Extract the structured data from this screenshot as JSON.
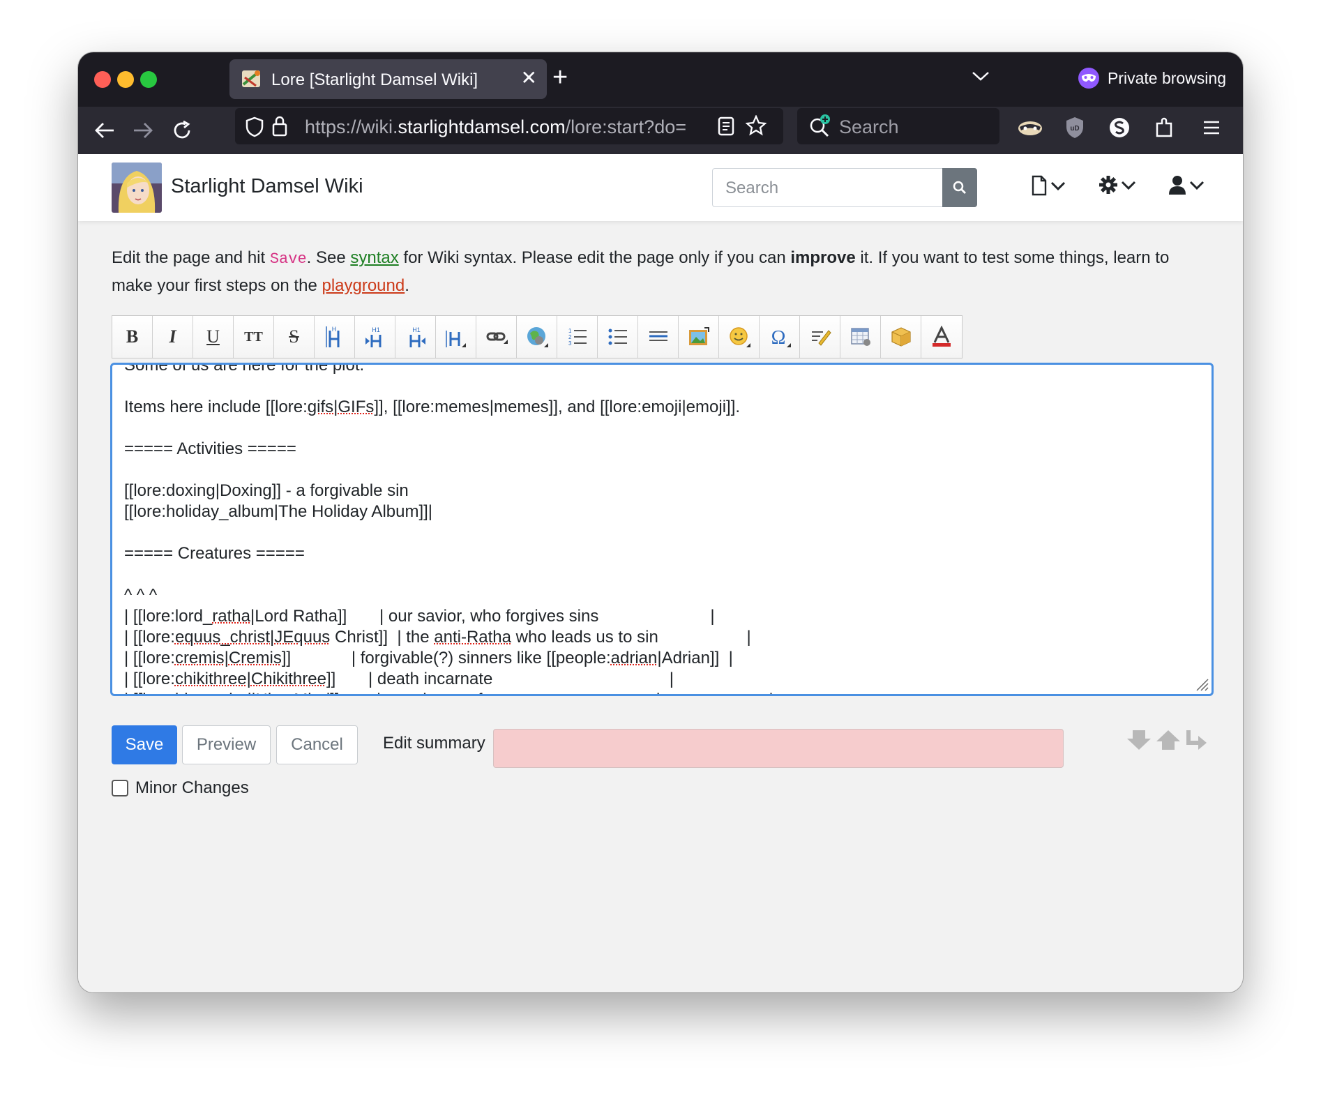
{
  "browser": {
    "tab_title": "Lore [Starlight Damsel Wiki]",
    "private_label": "Private browsing",
    "url_prefix": "https://wiki.",
    "url_domain": "starlightdamsel.com",
    "url_path": "/lore:start?do=",
    "search_placeholder": "Search"
  },
  "wiki": {
    "site_title": "Starlight Damsel Wiki",
    "search_placeholder": "Search"
  },
  "intro": {
    "t1": "Edit the page and hit ",
    "save": "Save",
    "t2": ". See ",
    "syntax": "syntax",
    "t3": " for Wiki syntax. Please edit the page only if you can ",
    "improve": "improve",
    "t4": " it. If you want to test some things, learn to make your first steps on the ",
    "playground": "playground",
    "t5": "."
  },
  "toolbar": {
    "buttons": [
      "bold",
      "italic",
      "underline",
      "monospace",
      "strikethrough",
      "heading-same",
      "heading-lower",
      "heading-higher",
      "heading-select",
      "link",
      "external-link",
      "ordered-list",
      "unordered-list",
      "horizontal-rule",
      "media",
      "smileys",
      "special-chars",
      "signature",
      "table",
      "plugin",
      "color"
    ]
  },
  "editor": {
    "l0": "Some of us are here for the plot.",
    "l1a": "Items here include [[lore:",
    "l1b": "gifs",
    "l1c": "|",
    "l1d": "GIFs",
    "l1e": "]], [[lore:memes|memes]], and [[lore:emoji|emoji]].",
    "l2": "===== Activities =====",
    "l3": "[[lore:doxing|Doxing]] - a forgivable sin",
    "l4": "[[lore:holiday_album|The Holiday Album]]|",
    "l5": "===== Creatures =====",
    "l6": "^ ^ ^",
    "r1a": "| [[lore:lord_",
    "r1b": "ratha",
    "r1c": "|Lord Ratha]]       | our savior, who forgives sins                        |",
    "r2a": "| [[lore:",
    "r2b": "equus_christ",
    "r2c": "|",
    "r2d": "JEquus",
    "r2e": " Christ]]  | the ",
    "r2f": "anti-Ratha",
    "r2g": " who leads us to sin                   |",
    "r3a": "| [[lore:",
    "r3b": "cremis",
    "r3c": "|",
    "r3d": "Cremis",
    "r3e": "]]             | forgivable(?) sinners like [[people:",
    "r3f": "adrian",
    "r3g": "|Adrian]]  |",
    "r4a": "| [[lore:",
    "r4b": "chikithree",
    "r4c": "|",
    "r4d": "Chikithree",
    "r4e": "]]       | death incarnate                                      |",
    "r5a": "| [[lore:hive_mind|Hive Mind]]        | together we form a ",
    "r5b": "commun",
    "r5c": "....consciousness          |"
  },
  "form": {
    "save": "Save",
    "preview": "Preview",
    "cancel": "Cancel",
    "summary_label": "Edit summary",
    "minor_label": "Minor Changes"
  }
}
